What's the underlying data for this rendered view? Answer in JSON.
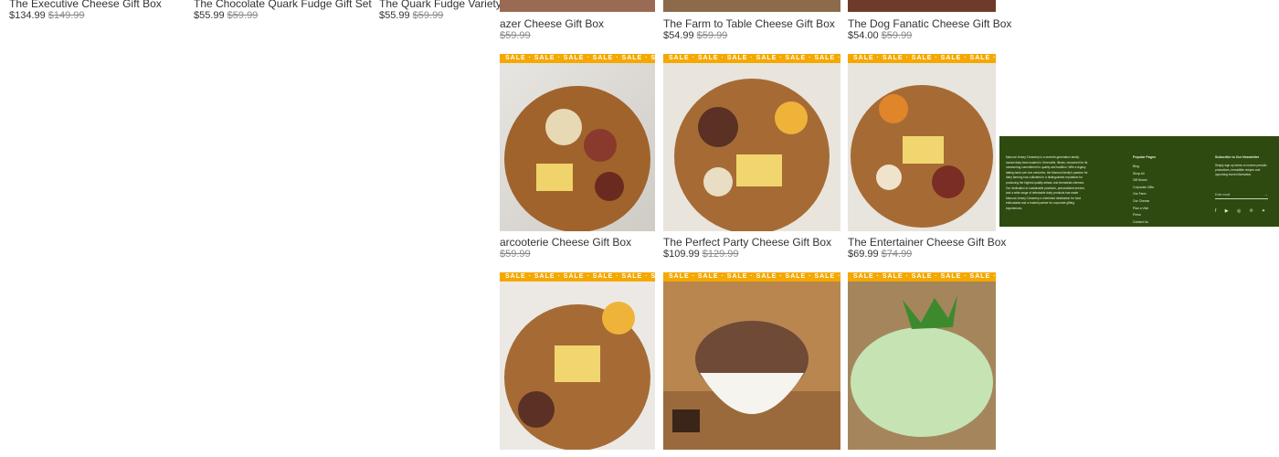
{
  "top_left_products": [
    {
      "title": "The Executive Cheese Gift Box",
      "price": "$134.99",
      "old_price": "$149.99"
    },
    {
      "title": "The Chocolate Quark Fudge Gift Set",
      "price": "$55.99",
      "old_price": "$59.99"
    },
    {
      "title": "The Quark Fudge Variety Gift Box",
      "price": "$55.99",
      "old_price": "$59.99"
    }
  ],
  "sale_banner": "SALE · SALE · SALE · SALE · SALE · SALE · SALE · SALE · SALE · SALE",
  "grid_row1": [
    {
      "title": "azer Cheese Gift Box",
      "price": "",
      "old_price": "$59.99"
    },
    {
      "title": "The Farm to Table Cheese Gift Box",
      "price": "$54.99",
      "old_price": "$59.99"
    },
    {
      "title": "The Dog Fanatic Cheese Gift Box",
      "price": "$54.00",
      "old_price": "$59.99"
    }
  ],
  "grid_row2": [
    {
      "title": "arcooterie Cheese Gift Box",
      "price": "",
      "old_price": "$59.99"
    },
    {
      "title": "The Perfect Party Cheese Gift Box",
      "price": "$109.99",
      "old_price": "$129.99"
    },
    {
      "title": "The Entertainer Cheese Gift Box",
      "price": "$69.99",
      "old_price": "$74.99"
    }
  ],
  "footer": {
    "about": "Marcoot Jersey Creamery is a seventh-generation family-owned dairy farm located in Greenville, Illinois, renowned for its unwavering commitment to quality and tradition. With a legacy dating back over two centuries, the Marcoot family's passion for dairy farming has cultivated in a distinguished reputation for producing the highest quality artisan and farmstead cheeses. Our dedication to sustainable practices, personalized service, and a wide range of delectable dairy products has made Marcoot Jersey Creamery a cherished destination for food enthusiasts and a trusted partner for corporate gifting experiences.",
    "popular_heading": "Popular Pages",
    "links": [
      "Blog",
      "Shop All",
      "Gift Boxes",
      "Corporate Gifts",
      "Our Farm",
      "Our Cheese",
      "Plan a Visit",
      "Press",
      "Contact Us"
    ],
    "newsletter_heading": "Subscribe to Our Newsletter",
    "newsletter_text": "Simply sign up below to receive periodic promotions, irresistible recipes and upcoming event information.",
    "email_placeholder": "Enter email",
    "arrow": "→",
    "social": "f ▶ ◎ ℗ ✦"
  }
}
